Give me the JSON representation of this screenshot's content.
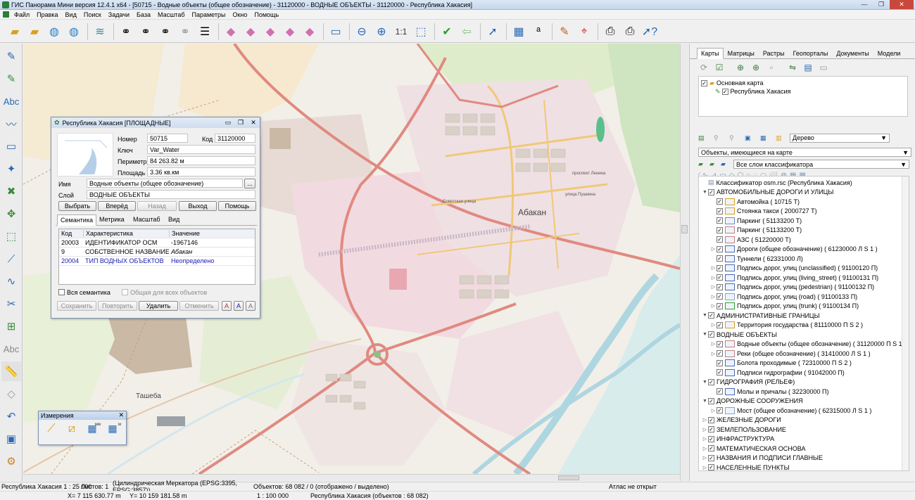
{
  "window": {
    "title": "ГИС Панорама Мини версия 12.4.1 x64 - [50715 - Водные объекты (общее обозначение) - 31120000 - ВОДНЫЕ ОБЪЕКТЫ - 31120000 - Республика Хакасия]",
    "minimize": "—",
    "maximize": "❐",
    "close": "✕"
  },
  "menu": [
    "Файл",
    "Правка",
    "Вид",
    "Поиск",
    "Задачи",
    "База",
    "Масштаб",
    "Параметры",
    "Окно",
    "Помощь"
  ],
  "map_labels": {
    "city": "Абакан",
    "town": "Ташеба",
    "street1": "Советская улица",
    "street2": "проспект Ленина",
    "street3": "улица Пушкина"
  },
  "dialog": {
    "title": "Республика Хакасия [ПЛОЩАДНЫЕ]",
    "number_label": "Номер",
    "number": "50715",
    "code_label": "Код",
    "code": "31120000",
    "key_label": "Ключ",
    "key": "Var_Water",
    "perimeter_label": "Периметр",
    "perimeter": "84 263.82 м",
    "area_label": "Площадь",
    "area": "3.36 кв.км",
    "name_label": "Имя",
    "name": "Водные объекты (общее обозначение)",
    "more": "...",
    "layer_label": "Слой",
    "layer": "ВОДНЫЕ ОБЪЕКТЫ",
    "buttons": {
      "select": "Выбрать",
      "forward": "Вперёд",
      "back": "Назад",
      "exit": "Выход",
      "help": "Помощь"
    },
    "tabs": [
      "Семантика",
      "Метрика",
      "Масштаб",
      "Вид"
    ],
    "grid_headers": [
      "Код",
      "Характеристика",
      "Значение"
    ],
    "grid_rows": [
      [
        "20003",
        "ИДЕНТИФИКАТОР ОСМ",
        "-1967146"
      ],
      [
        "9",
        "СОБСТВЕННОЕ НАЗВАНИЕ",
        "Абакан"
      ],
      [
        "20004",
        "ТИП ВОДНЫХ ОБЪЕКТОВ",
        "Неопределено"
      ]
    ],
    "all_semantics": "Вся семантика",
    "common_all": "Общая для всех объектов",
    "save": "Сохранить",
    "repeat": "Повторить",
    "delete": "Удалить",
    "cancel": "Отменить",
    "font_btns": [
      "A",
      "A",
      "A"
    ]
  },
  "measure": {
    "title": "Измерения",
    "close": "✕",
    "labels": [
      "мм",
      "м"
    ]
  },
  "right_panel": {
    "tabs": [
      "Карты",
      "Матрицы",
      "Растры",
      "Геопорталы",
      "Документы",
      "Модели"
    ],
    "layers_root": "Основная карта",
    "layer_child": "Республика Хакасия",
    "view_select": "Дерево",
    "objects_select": "Объекты, имеющиеся на карте",
    "classifier_select": "Все слои классификатора",
    "tree": [
      {
        "lvl": 0,
        "exp": "",
        "cb": false,
        "sym": false,
        "text": "Классификатор osm.rsc (Республика Хакасия)"
      },
      {
        "lvl": 0,
        "exp": "▼",
        "cb": true,
        "sym": false,
        "text": "АВТОМОБИЛЬНЫЕ ДОРОГИ И УЛИЦЫ"
      },
      {
        "lvl": 1,
        "exp": "",
        "cb": true,
        "sym": true,
        "text": "Автомойка ( 10715 Т)"
      },
      {
        "lvl": 1,
        "exp": "",
        "cb": true,
        "sym": true,
        "text": "Стоянка такси ( 2000727 Т)"
      },
      {
        "lvl": 1,
        "exp": "",
        "cb": true,
        "sym": true,
        "text": "Паркинг ( 51133200 Т)"
      },
      {
        "lvl": 1,
        "exp": "",
        "cb": true,
        "sym": true,
        "text": "Паркинг ( 51133200 Т)"
      },
      {
        "lvl": 1,
        "exp": "",
        "cb": true,
        "sym": true,
        "text": "АЗС ( 51220000 Т)"
      },
      {
        "lvl": 1,
        "exp": "▷",
        "cb": true,
        "sym": true,
        "text": "Дороги (общее обозначение) ( 61230000 Л S 1 )"
      },
      {
        "lvl": 1,
        "exp": "",
        "cb": true,
        "sym": true,
        "text": "Туннели ( 62331000 Л)"
      },
      {
        "lvl": 1,
        "exp": "▷",
        "cb": true,
        "sym": true,
        "text": "Подпись дорог, улиц (unclassified) ( 91100120 П)"
      },
      {
        "lvl": 1,
        "exp": "▷",
        "cb": true,
        "sym": true,
        "text": "Подпись дорог, улиц (living_street) ( 91100131 П)"
      },
      {
        "lvl": 1,
        "exp": "▷",
        "cb": true,
        "sym": true,
        "text": "Подпись дорог, улиц (pedestrian) ( 91100132 П)"
      },
      {
        "lvl": 1,
        "exp": "▷",
        "cb": true,
        "sym": true,
        "text": "Подпись дорог, улиц (road) ( 91100133 П)"
      },
      {
        "lvl": 1,
        "exp": "▷",
        "cb": true,
        "sym": true,
        "text": "Подпись дорог, улиц (trunk) ( 91100134 П)"
      },
      {
        "lvl": 0,
        "exp": "▼",
        "cb": true,
        "sym": false,
        "text": "АДМИНИСТРАТИВНЫЕ ГРАНИЦЫ"
      },
      {
        "lvl": 1,
        "exp": "▷",
        "cb": true,
        "sym": true,
        "text": "Территория государства ( 81110000 П S 2 )"
      },
      {
        "lvl": 0,
        "exp": "▼",
        "cb": true,
        "sym": false,
        "text": "ВОДНЫЕ ОБЪЕКТЫ"
      },
      {
        "lvl": 1,
        "exp": "▷",
        "cb": true,
        "sym": true,
        "text": "Водные объекты (общее обозначение) ( 31120000 П S 1"
      },
      {
        "lvl": 1,
        "exp": "▷",
        "cb": true,
        "sym": true,
        "text": "Реки (общее обозначение) ( 31410000 Л S 1 )"
      },
      {
        "lvl": 1,
        "exp": "",
        "cb": true,
        "sym": true,
        "text": "Болота проходимые ( 72310000 П S 2 )"
      },
      {
        "lvl": 1,
        "exp": "",
        "cb": true,
        "sym": true,
        "text": "Подписи гидрографии ( 91042000 П)"
      },
      {
        "lvl": 0,
        "exp": "▼",
        "cb": true,
        "sym": false,
        "text": "ГИДРОГРАФИЯ (РЕЛЬЕФ)"
      },
      {
        "lvl": 1,
        "exp": "",
        "cb": true,
        "sym": true,
        "text": "Молы и причалы ( 32230000 П)"
      },
      {
        "lvl": 0,
        "exp": "▼",
        "cb": true,
        "sym": false,
        "text": "ДОРОЖНЫЕ СООРУЖЕНИЯ"
      },
      {
        "lvl": 1,
        "exp": "▷",
        "cb": true,
        "sym": true,
        "text": "Мост (общее обозначение) ( 62315000 Л S 1 )"
      },
      {
        "lvl": 0,
        "exp": "▷",
        "cb": true,
        "sym": false,
        "text": "ЖЕЛЕЗНЫЕ ДОРОГИ"
      },
      {
        "lvl": 0,
        "exp": "▷",
        "cb": true,
        "sym": false,
        "text": "ЗЕМЛЕПОЛЬЗОВАНИЕ"
      },
      {
        "lvl": 0,
        "exp": "▷",
        "cb": true,
        "sym": false,
        "text": "ИНФРАСТРУКТУРА"
      },
      {
        "lvl": 0,
        "exp": "▷",
        "cb": true,
        "sym": false,
        "text": "МАТЕМАТИЧЕСКАЯ ОСНОВА"
      },
      {
        "lvl": 0,
        "exp": "▷",
        "cb": true,
        "sym": false,
        "text": "НАЗВАНИЯ И ПОДПИСИ ГЛАВНЫЕ"
      },
      {
        "lvl": 0,
        "exp": "▷",
        "cb": true,
        "sym": false,
        "text": "НАСЕЛЕННЫЕ ПУНКТЫ"
      }
    ]
  },
  "status": {
    "map": "Республика Хакасия",
    "scale": "1 : 25 000",
    "sheets": "Листов: 1",
    "projection": "(Цилиндрическая Меркатора (EPSG:3395, EPSG:3857))",
    "objects": "Объектов: 68 082 / 0 (отображено / выделено)",
    "atlas": "Атлас не открыт",
    "x": "X= 7 115 630.77 m",
    "y": "Y= 10 159 181.58 m",
    "scale2": "1 : 100 000",
    "map2": "Республика Хакасия  (объектов : 68 082)"
  },
  "icons": [
    "open-icon",
    "save-icon",
    "globe-icon",
    "layers-icon",
    "binoculars-icon",
    "select-icon",
    "zoom-out-icon",
    "zoom-in-icon",
    "check-icon",
    "print-icon",
    "help-icon"
  ]
}
